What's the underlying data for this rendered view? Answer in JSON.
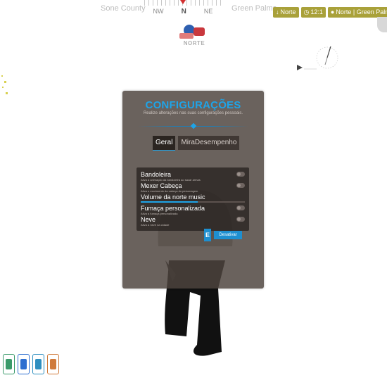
{
  "hud": {
    "street_left": "Sone County",
    "street_right": "Green Palms",
    "compass_dirs": [
      "NW",
      "N",
      "NE"
    ]
  },
  "badges": [
    {
      "icon": "pin-icon",
      "text": "Norte"
    },
    {
      "icon": "clock-icon",
      "text": "12:1"
    },
    {
      "icon": "location-icon",
      "text": "Norte | Green Palms"
    }
  ],
  "logo": {
    "text": "NORTE"
  },
  "settings": {
    "title": "CONFIGURAÇÕES",
    "subtitle": "Realize alterações nas suas configurações pessoais.",
    "tabs": [
      "Geral",
      "MiraDesempenho"
    ],
    "active_tab": "Geral",
    "options": [
      {
        "label": "Bandoleira",
        "desc": "Ativa a animação da bandoleira ao sacar armas"
      },
      {
        "label": "Mexer Cabeça",
        "desc": "Ativa o movimento da cabeça do personagem"
      },
      {
        "label": "Volume da norte music",
        "desc": "",
        "volume": 0.55
      },
      {
        "label": "Fumaça personalizada",
        "desc": "Ativa a fumaça personalizada"
      },
      {
        "label": "Neve",
        "desc": "Ativa a neve na cidade"
      }
    ],
    "key_hint": "E",
    "deactivate_label": "Desativar"
  },
  "colors": {
    "accent": "#1ea4e8",
    "badge": "#a9a13a",
    "panel": "#4e443e"
  },
  "status": [
    {
      "name": "health-icon",
      "color": "#3a9a6a"
    },
    {
      "name": "armor-icon",
      "color": "#2e6fd0"
    },
    {
      "name": "water-icon",
      "color": "#2e8fc0"
    },
    {
      "name": "food-icon",
      "color": "#d07a3a"
    }
  ]
}
